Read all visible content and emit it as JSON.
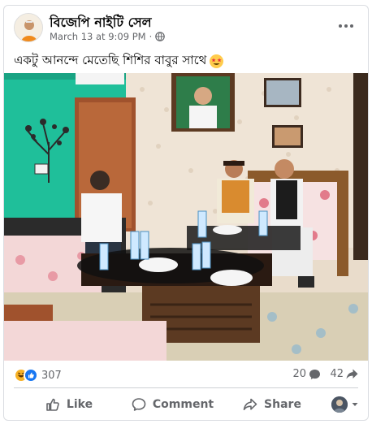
{
  "post": {
    "page_name": "বিজেপি নাইটি সেল",
    "timestamp": "March 13 at 9:09 PM",
    "separator": "·",
    "caption": "একটু আনন্দে মেতেছি শিশির বাবুর সাথে",
    "caption_emoji": "star-struck-emoji"
  },
  "stats": {
    "reaction_count": "307",
    "reaction_icons": [
      "haha-icon",
      "like-icon"
    ],
    "comment_count": "20",
    "share_count": "42"
  },
  "actions": {
    "like_label": "Like",
    "comment_label": "Comment",
    "share_label": "Share"
  },
  "colors": {
    "wall_green": "#1fbf9a",
    "accent_gray": "#65676b",
    "divider": "#ced0d4"
  }
}
